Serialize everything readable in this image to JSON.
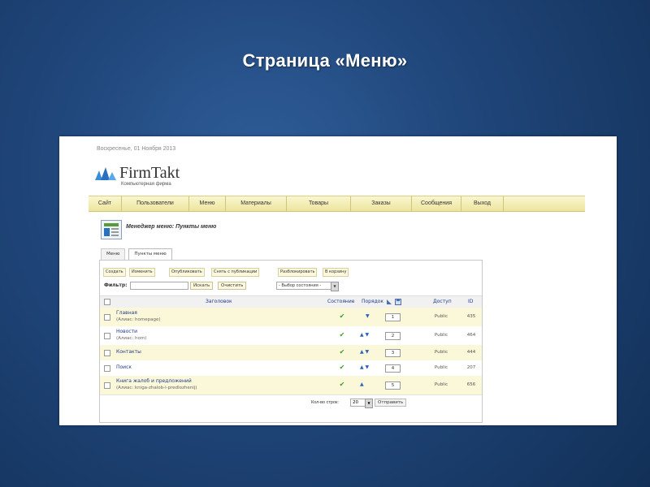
{
  "slide": {
    "title": "Страница «Меню»"
  },
  "site": {
    "date": "Воскресенье, 01 Ноября 2013",
    "logo_name": "FirmTakt",
    "logo_tagline": "Компьютерная фирма",
    "nav": [
      "Сайт",
      "Пользователи",
      "Меню",
      "Материалы",
      "Товары",
      "Заказы",
      "Сообщения",
      "Выход"
    ]
  },
  "manager": {
    "title": "Менеджер меню: Пункты меню"
  },
  "tabs": [
    "Меню",
    "Пункты меню"
  ],
  "toolbar": [
    "Создать",
    "Изменить",
    "Опубликовать",
    "Снять с публикации",
    "Разблокировать",
    "В корзину"
  ],
  "filter": {
    "label": "Фильтр:",
    "value": "",
    "search_button": "Искать",
    "clear_button": "Очистить",
    "state_select": "- Выбор состояния -"
  },
  "table": {
    "headers": {
      "title": "Заголовок",
      "state": "Состояние",
      "order": "Порядок",
      "access": "Доступ",
      "id": "ID"
    },
    "rows": [
      {
        "title": "Главная",
        "alias": "(Алиас: homepage)",
        "order_arrows": "▼",
        "order": "1",
        "access": "Public",
        "id": "435"
      },
      {
        "title": "Новости",
        "alias": "(Алиас: hom)",
        "order_arrows": "▲ ▼",
        "order": "2",
        "access": "Public",
        "id": "464"
      },
      {
        "title": "Контакты",
        "alias": "",
        "order_arrows": "▲ ▼",
        "order": "3",
        "access": "Public",
        "id": "444"
      },
      {
        "title": "Поиск",
        "alias": "",
        "order_arrows": "▲ ▼",
        "order": "4",
        "access": "Public",
        "id": "207"
      },
      {
        "title": "Книга жалоб и предложений",
        "alias": "(Алиас: kniga-zhalob-i-predlozhenij)",
        "order_arrows": "▲",
        "order": "5",
        "access": "Public",
        "id": "656"
      }
    ]
  },
  "footer": {
    "rows_label": "Кол-во строк:",
    "rows_value": "20",
    "send_button": "Отправить"
  }
}
